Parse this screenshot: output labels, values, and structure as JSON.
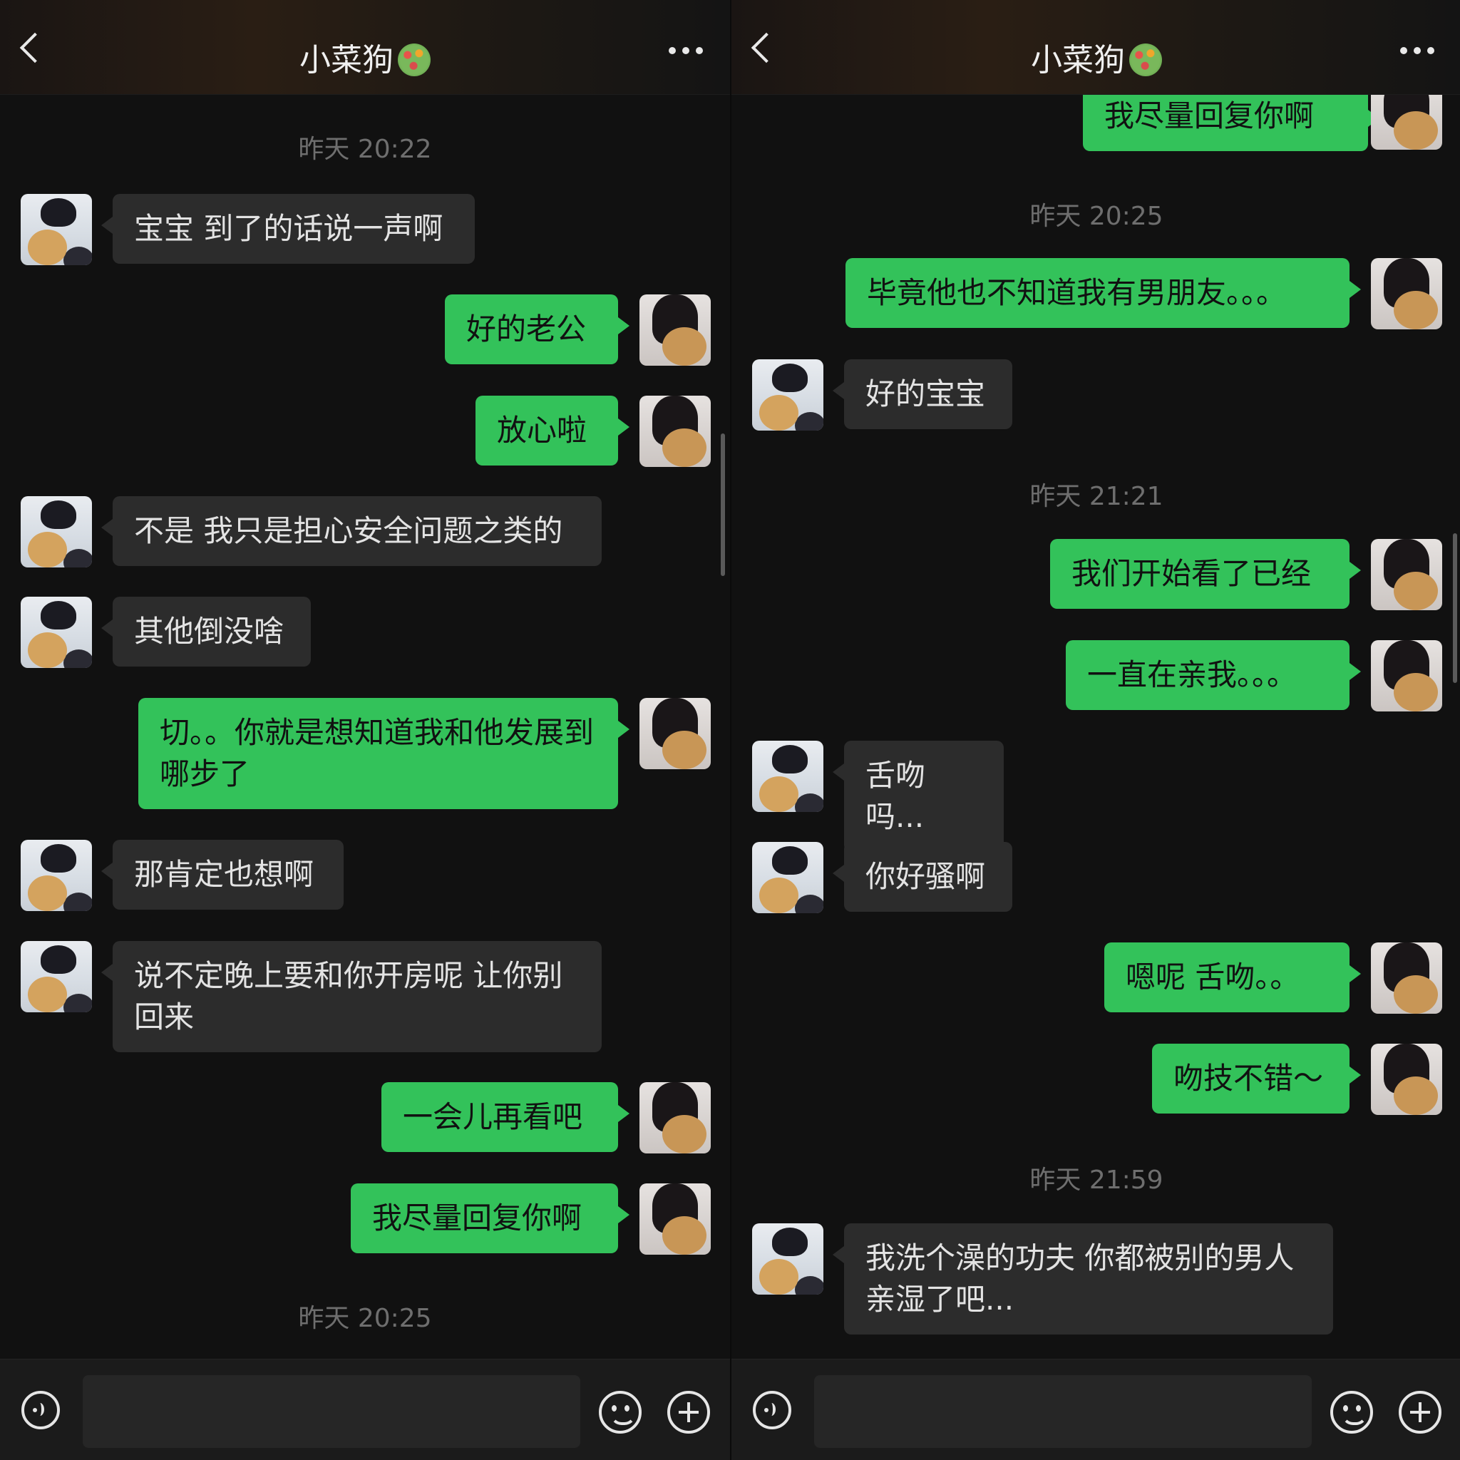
{
  "chat": {
    "title": "小菜狗",
    "input_placeholder": ""
  },
  "left_screen": {
    "timestamps": [
      "昨天 20:22",
      "昨天 20:25"
    ],
    "messages": [
      {
        "from": "contact",
        "text": "宝宝 到了的话说一声啊"
      },
      {
        "from": "me",
        "text": "好的老公"
      },
      {
        "from": "me",
        "text": "放心啦"
      },
      {
        "from": "contact",
        "text": "不是 我只是担心安全问题之类的"
      },
      {
        "from": "contact",
        "text": "其他倒没啥"
      },
      {
        "from": "me",
        "text": "切。。你就是想知道我和他发展到哪步了"
      },
      {
        "from": "contact",
        "text": "那肯定也想啊"
      },
      {
        "from": "contact",
        "text": "说不定晚上要和你开房呢 让你别回来"
      },
      {
        "from": "me",
        "text": "一会儿再看吧"
      },
      {
        "from": "me",
        "text": "我尽量回复你啊"
      }
    ]
  },
  "right_screen": {
    "timestamps": [
      "昨天 20:25",
      "昨天 21:21",
      "昨天 21:59"
    ],
    "messages": [
      {
        "from": "me",
        "text": "我尽量回复你啊"
      },
      {
        "from": "me",
        "text": "毕竟他也不知道我有男朋友。。。"
      },
      {
        "from": "contact",
        "text": "好的宝宝"
      },
      {
        "from": "me",
        "text": "我们开始看了已经"
      },
      {
        "from": "me",
        "text": "一直在亲我。。。"
      },
      {
        "from": "contact",
        "text": "舌吻吗..."
      },
      {
        "from": "contact",
        "text": "你好骚啊"
      },
      {
        "from": "me",
        "text": "嗯呢 舌吻。。"
      },
      {
        "from": "me",
        "text": "吻技不错～"
      },
      {
        "from": "contact",
        "text": "我洗个澡的功夫 你都被别的男人亲湿了吧..."
      }
    ]
  },
  "colors": {
    "background": "#111111",
    "incoming_bubble": "#2c2c2c",
    "outgoing_bubble": "#33c25a",
    "timestamp": "#6e6e6e"
  },
  "icons": [
    "back-icon",
    "status-emoji-icon",
    "more-icon",
    "voice-icon",
    "emoji-icon",
    "plus-icon"
  ]
}
